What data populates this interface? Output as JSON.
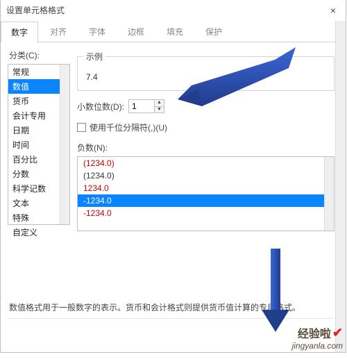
{
  "dialog": {
    "title": "设置单元格格式",
    "close_glyph": "×"
  },
  "tabs": {
    "number": "数字",
    "alignment": "对齐",
    "font": "字体",
    "border": "边框",
    "fill": "填充",
    "protection": "保护"
  },
  "category": {
    "label": "分类(C):",
    "items": {
      "general": "常规",
      "number": "数值",
      "currency": "货币",
      "accounting": "会计专用",
      "date": "日期",
      "time": "时间",
      "percentage": "百分比",
      "fraction": "分数",
      "scientific": "科学记数",
      "text": "文本",
      "special": "特殊",
      "custom": "自定义"
    }
  },
  "example": {
    "legend": "示例",
    "value": "7.4"
  },
  "decimals": {
    "label": "小数位数(D):",
    "value": "1",
    "up_glyph": "▲",
    "down_glyph": "▼"
  },
  "thousands": {
    "label": "使用千位分隔符(,)(U)"
  },
  "negative": {
    "label": "负数(N):",
    "items": {
      "a": "(1234.0)",
      "b": "(1234.0)",
      "c": "1234.0",
      "d": "-1234.0",
      "e": "-1234.0"
    }
  },
  "description": "数值格式用于一般数字的表示。货币和会计格式则提供货币值计算的专用格式。",
  "watermark": {
    "line1": "经验啦",
    "check_glyph": "✔",
    "line2": "jingyanla.com"
  }
}
